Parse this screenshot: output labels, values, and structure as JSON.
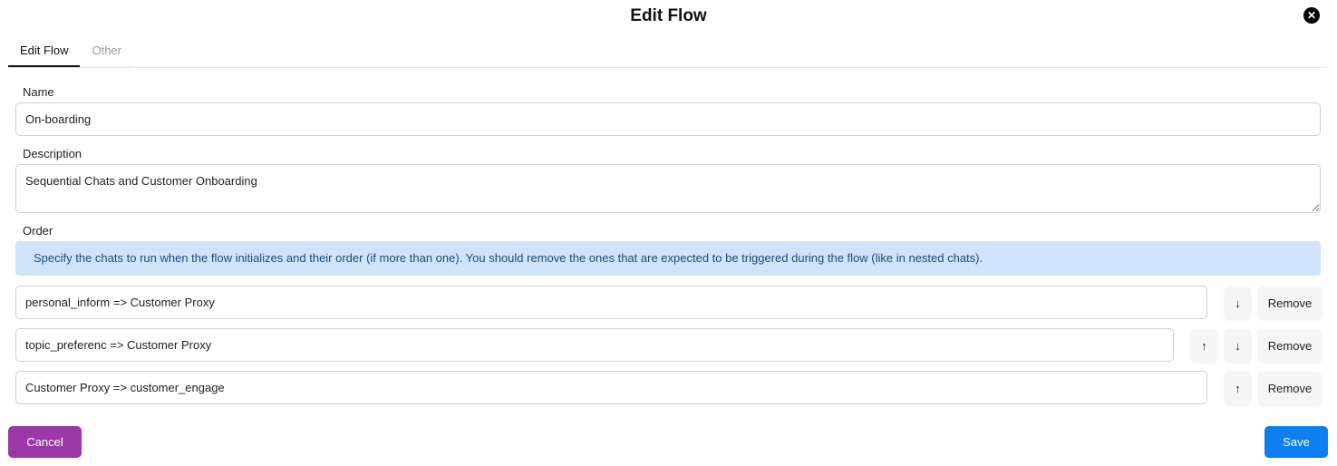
{
  "dialog": {
    "title": "Edit Flow",
    "close_icon": "close-icon"
  },
  "tabs": [
    {
      "label": "Edit Flow",
      "active": true
    },
    {
      "label": "Other",
      "active": false
    }
  ],
  "form": {
    "name_label": "Name",
    "name_value": "On-boarding",
    "description_label": "Description",
    "description_value": "Sequential Chats and Customer Onboarding",
    "order_label": "Order",
    "order_info": "Specify the chats to run when the flow initializes and their order (if more than one). You should remove the ones that are expected to be triggered during the flow (like in nested chats)."
  },
  "order_items": [
    {
      "value": "personal_inform => Customer Proxy",
      "up": false,
      "down": true,
      "remove_label": "Remove"
    },
    {
      "value": "topic_preferenc => Customer Proxy",
      "up": true,
      "down": true,
      "remove_label": "Remove"
    },
    {
      "value": "Customer Proxy => customer_engage",
      "up": true,
      "down": false,
      "remove_label": "Remove"
    }
  ],
  "icons": {
    "up": "↑",
    "down": "↓",
    "close": "✕"
  },
  "footer": {
    "cancel_label": "Cancel",
    "save_label": "Save"
  },
  "colors": {
    "cancel": "#9b38a7",
    "save": "#0d7ff2",
    "info_bg": "#cfe4fb",
    "info_text": "#1d4a78"
  }
}
